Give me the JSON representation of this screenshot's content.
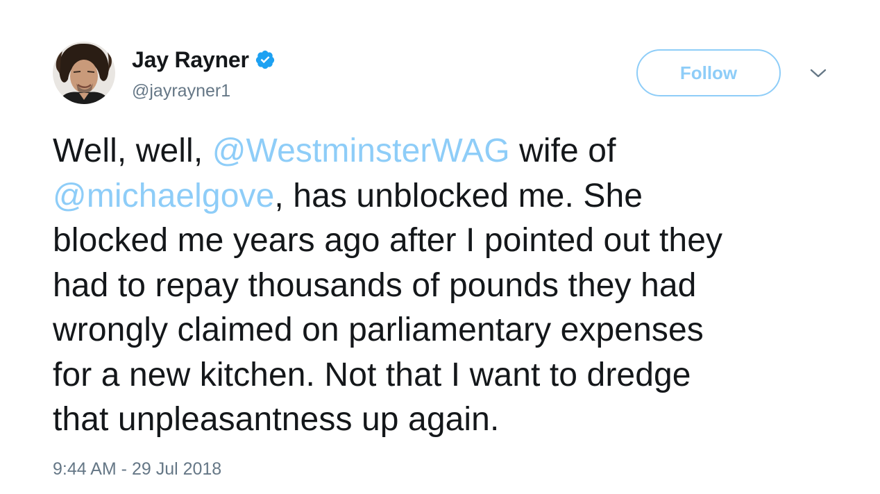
{
  "author": {
    "display_name": "Jay Rayner",
    "handle": "@jayrayner1",
    "verified": true
  },
  "actions": {
    "follow_label": "Follow"
  },
  "tweet": {
    "lines": [
      {
        "mention": "",
        "before": "Well, well, ",
        "link": "@WestminsterWAG",
        "after": " wife of"
      },
      {
        "before": "",
        "link": "@michaelgove",
        "after": ", has unblocked me. She"
      },
      {
        "before": "blocked me years ago after I pointed out they",
        "link": "",
        "after": ""
      },
      {
        "before": "had to repay thousands of pounds they had",
        "link": "",
        "after": ""
      },
      {
        "before": "wrongly claimed on parliamentary expenses",
        "link": "",
        "after": ""
      },
      {
        "before": "for a new kitchen. Not that I want to dredge",
        "link": "",
        "after": ""
      },
      {
        "before": "that unpleasantness up again.",
        "link": "",
        "after": ""
      }
    ],
    "timestamp": "9:44 AM - 29 Jul 2018"
  },
  "colors": {
    "link": "#8ecdf8",
    "verified_badge": "#1da1f2",
    "secondary_text": "#657786",
    "primary_text": "#14171a"
  },
  "icons": {
    "verified": "verified-badge-icon",
    "caret": "chevron-down-icon"
  }
}
